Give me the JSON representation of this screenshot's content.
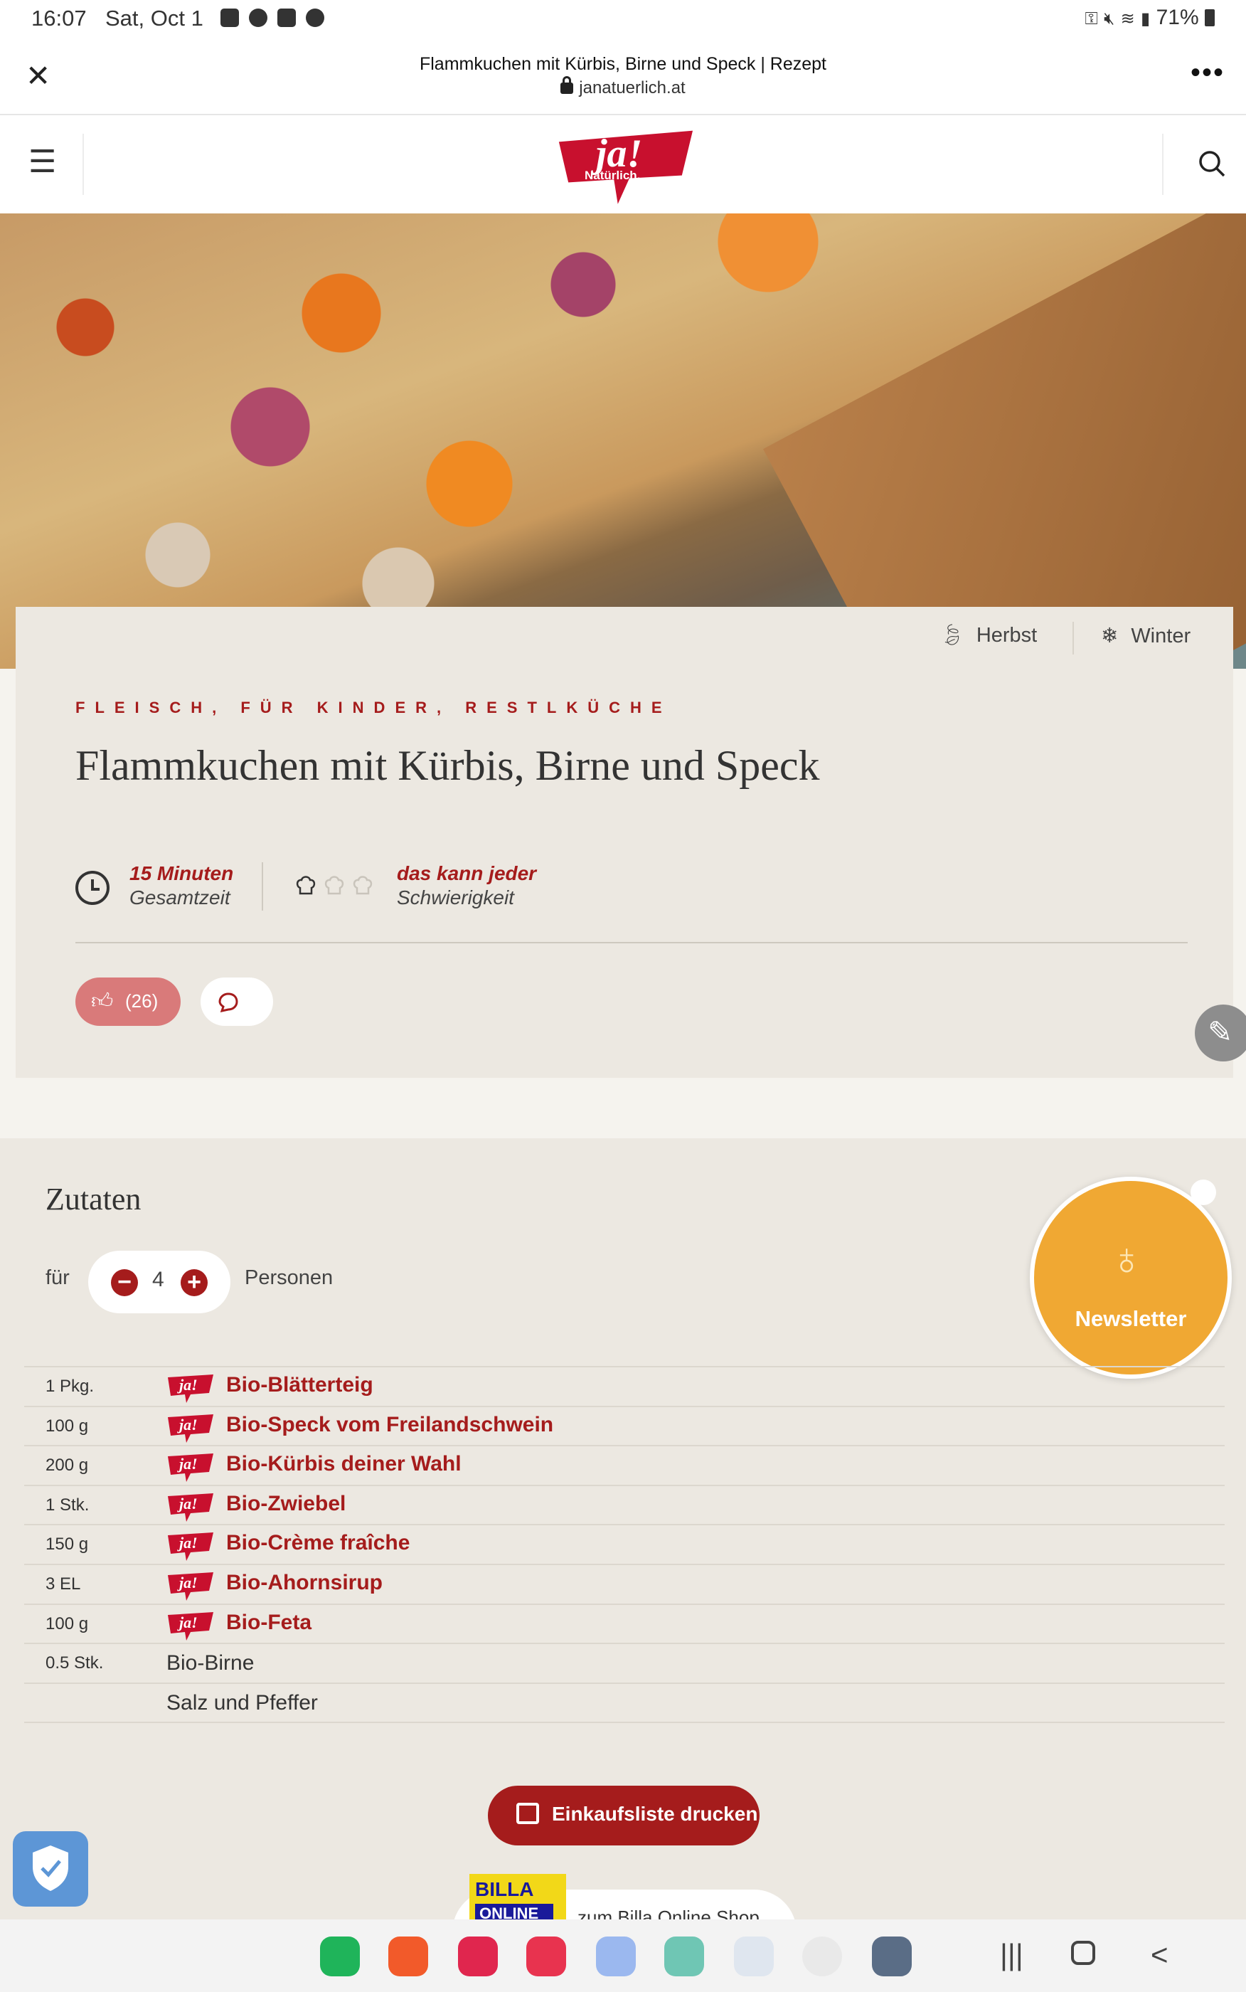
{
  "status_bar": {
    "time": "16:07",
    "date": "Sat, Oct 1",
    "battery": "71%"
  },
  "browser": {
    "title": "Flammkuchen mit Kürbis, Birne und Speck | Rezept",
    "url": "janatuerlich.at",
    "close_icon": "✕",
    "more_icon": "•••"
  },
  "site": {
    "logo_text": "ja!",
    "logo_sub": "Natürlich."
  },
  "recipe": {
    "seasons": [
      "Herbst",
      "Winter"
    ],
    "categories": "FLEISCH, FÜR KINDER, RESTLKÜCHE",
    "title": "Flammkuchen mit Kürbis, Birne und Speck",
    "time_value": "15 Minuten",
    "time_label": "Gesamtzeit",
    "difficulty_value": "das kann jeder",
    "difficulty_label": "Schwierigkeit",
    "difficulty_level": 1,
    "difficulty_max": 3,
    "likes": "(26)"
  },
  "ingredients": {
    "heading": "Zutaten",
    "for_label": "für",
    "servings": "4",
    "persons_label": "Personen",
    "items": [
      {
        "amount": "1 Pkg.",
        "name": "Bio-Blätterteig",
        "branded": true
      },
      {
        "amount": "100 g",
        "name": "Bio-Speck vom Freilandschwein",
        "branded": true
      },
      {
        "amount": "200 g",
        "name": "Bio-Kürbis deiner Wahl",
        "branded": true
      },
      {
        "amount": "1 Stk.",
        "name": "Bio-Zwiebel",
        "branded": true
      },
      {
        "amount": "150 g",
        "name": "Bio-Crème fraîche",
        "branded": true
      },
      {
        "amount": "3 EL",
        "name": "Bio-Ahornsirup",
        "branded": true
      },
      {
        "amount": "100 g",
        "name": "Bio-Feta",
        "branded": true
      },
      {
        "amount": "0.5 Stk.",
        "name": "Bio-Birne",
        "branded": false
      },
      {
        "amount": "",
        "name": "Salz und Pfeffer",
        "branded": false
      }
    ],
    "print_label": "Einkaufsliste drucken",
    "billa_line1": "BILLA",
    "billa_line2": "ONLINE",
    "billa_label": "zum Billa Online Shop"
  },
  "newsletter_label": "Newsletter",
  "colors": {
    "brand_red": "#a51c1c",
    "newsletter_orange": "#f0a833",
    "card_bg": "#ece8e1"
  }
}
